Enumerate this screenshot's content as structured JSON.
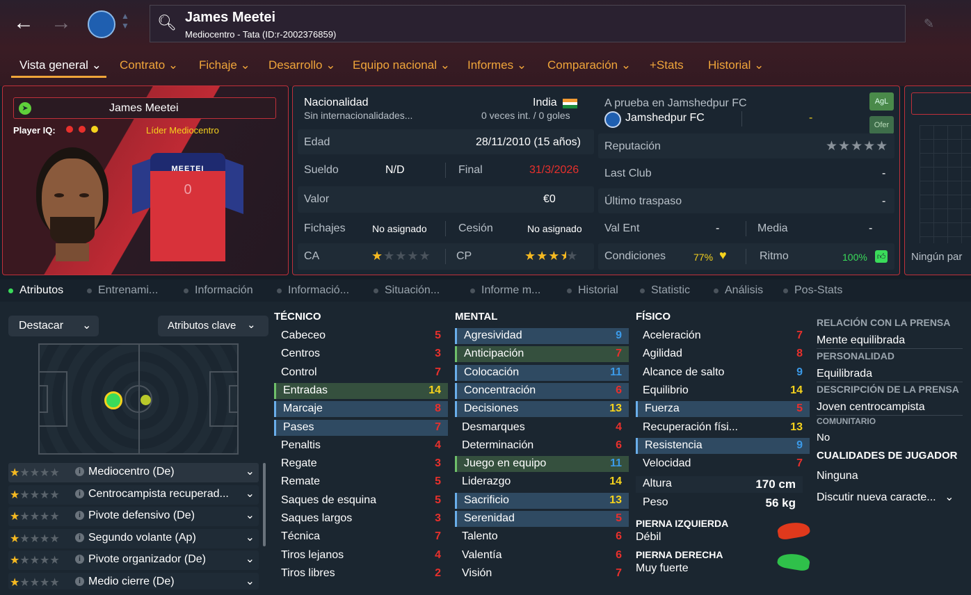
{
  "header": {
    "name": "James Meetei",
    "subtitle": "Mediocentro - Tata (ID:r-2002376859)"
  },
  "tabs": [
    "Vista general",
    "Contrato",
    "Fichaje",
    "Desarrollo",
    "Equipo nacional",
    "Informes",
    "Comparación",
    "+Stats",
    "Historial"
  ],
  "card": {
    "name": "James Meetei",
    "iq_label": "Player IQ:",
    "leader": "Líder",
    "role": "Mediocentro",
    "shirt_name": "MEETEI",
    "shirt_number": "0"
  },
  "info": {
    "nacionalidad_label": "Nacionalidad",
    "nacionalidad": "India",
    "internacionalidades": "Sin internacionalidades...",
    "caps": "0 veces int. / 0 goles",
    "edad_label": "Edad",
    "edad": "28/11/2010 (15 años)",
    "sueldo_label": "Sueldo",
    "sueldo": "N/D",
    "final_label": "Final",
    "final": "31/3/2026",
    "valor_label": "Valor",
    "valor": "€0",
    "fichajes_label": "Fichajes",
    "fichajes": "No asignado",
    "cesion_label": "Cesión",
    "cesion": "No asignado",
    "ca_label": "CA",
    "cp_label": "CP",
    "prueba": "A prueba en Jamshedpur FC",
    "club": "Jamshedpur FC",
    "club_dash": "-",
    "agl": "AgL",
    "ofer": "Ofer",
    "reputacion_label": "Reputación",
    "lastclub_label": "Last Club",
    "lastclub": "-",
    "ultimo_label": "Último traspaso",
    "ultimo": "-",
    "valent_label": "Val Ent",
    "valent": "-",
    "media_label": "Media",
    "media": "-",
    "condiciones_label": "Condiciones",
    "condiciones": "77%",
    "ritmo_label": "Ritmo",
    "ritmo": "100%",
    "ningun": "Ningún par"
  },
  "subtabs": [
    "Atributos",
    "Entrenami...",
    "Información",
    "Informació...",
    "Situación...",
    "Informe m...",
    "Historial",
    "Statistic",
    "Análisis",
    "Pos-Stats"
  ],
  "left": {
    "destacar": "Destacar",
    "atributos_clave": "Atributos clave"
  },
  "roles": [
    "Mediocentro (De)",
    "Centrocampista recuperad...",
    "Pivote defensivo (De)",
    "Segundo volante (Ap)",
    "Pivote organizador (De)",
    "Medio cierre (De)"
  ],
  "tecnico_label": "TÉCNICO",
  "mental_label": "MENTAL",
  "fisico_label": "FÍSICO",
  "tecnico": [
    [
      "Cabeceo",
      "5"
    ],
    [
      "Centros",
      "3"
    ],
    [
      "Control",
      "7"
    ],
    [
      "Entradas",
      "14"
    ],
    [
      "Marcaje",
      "8"
    ],
    [
      "Pases",
      "7"
    ],
    [
      "Penaltis",
      "4"
    ],
    [
      "Regate",
      "3"
    ],
    [
      "Remate",
      "5"
    ],
    [
      "Saques de esquina",
      "5"
    ],
    [
      "Saques largos",
      "3"
    ],
    [
      "Técnica",
      "7"
    ],
    [
      "Tiros lejanos",
      "4"
    ],
    [
      "Tiros libres",
      "2"
    ]
  ],
  "mental": [
    [
      "Agresividad",
      "9"
    ],
    [
      "Anticipación",
      "7"
    ],
    [
      "Colocación",
      "11"
    ],
    [
      "Concentración",
      "6"
    ],
    [
      "Decisiones",
      "13"
    ],
    [
      "Desmarques",
      "4"
    ],
    [
      "Determinación",
      "6"
    ],
    [
      "Juego en equipo",
      "11"
    ],
    [
      "Liderazgo",
      "14"
    ],
    [
      "Sacrificio",
      "13"
    ],
    [
      "Serenidad",
      "5"
    ],
    [
      "Talento",
      "6"
    ],
    [
      "Valentía",
      "6"
    ],
    [
      "Visión",
      "7"
    ]
  ],
  "fisico": [
    [
      "Aceleración",
      "7"
    ],
    [
      "Agilidad",
      "8"
    ],
    [
      "Alcance de salto",
      "9"
    ],
    [
      "Equilibrio",
      "14"
    ],
    [
      "Fuerza",
      "5"
    ],
    [
      "Recuperación físi...",
      "13"
    ],
    [
      "Resistencia",
      "9"
    ],
    [
      "Velocidad",
      "7"
    ]
  ],
  "altura_label": "Altura",
  "altura": "170 cm",
  "peso_label": "Peso",
  "peso": "56 kg",
  "pierna_izq_label": "PIERNA IZQUIERDA",
  "pierna_izq": "Débil",
  "pierna_der_label": "PIERNA DERECHA",
  "pierna_der": "Muy fuerte",
  "right": {
    "prensa_label": "RELACIÓN CON LA PRENSA",
    "prensa": "Mente equilibrada",
    "personalidad_label": "PERSONALIDAD",
    "personalidad": "Equilibrada",
    "desc_label": "DESCRIPCIÓN DE LA PRENSA",
    "desc": "Joven centrocampista",
    "comunitario_label": "COMUNITARIO",
    "comunitario": "No",
    "cualidades_label": "CUALIDADES DE JUGADOR",
    "cualidades": "Ninguna",
    "discutir": "Discutir nueva caracte..."
  }
}
